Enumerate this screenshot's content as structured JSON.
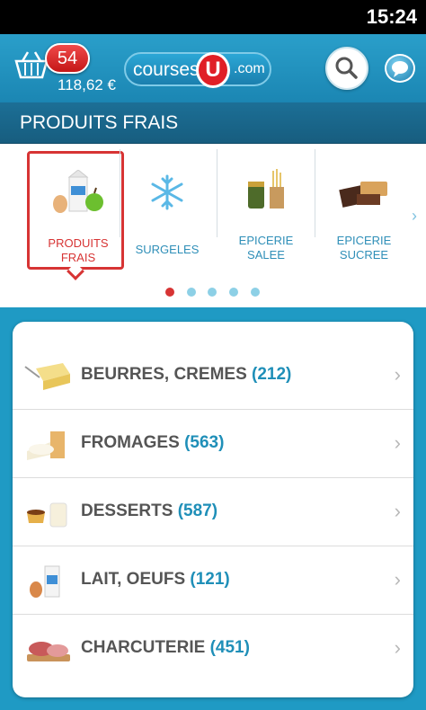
{
  "status_bar": {
    "time": "15:24"
  },
  "header": {
    "cart_count": "54",
    "cart_total": "118,62 €",
    "logo_part1": "courses",
    "logo_u": "U",
    "logo_part2": ".com"
  },
  "section": {
    "title": "PRODUITS FRAIS"
  },
  "carousel": {
    "items": [
      {
        "line1": "PRODUITS",
        "line2": "FRAIS",
        "active": true
      },
      {
        "line1": "SURGELES",
        "line2": "",
        "active": false
      },
      {
        "line1": "EPICERIE",
        "line2": "SALEE",
        "active": false
      },
      {
        "line1": "EPICERIE",
        "line2": "SUCREE",
        "active": false
      }
    ],
    "page_count": 5,
    "active_page": 1
  },
  "categories": [
    {
      "name": "BEURRES, CREMES",
      "count": "(212)"
    },
    {
      "name": "FROMAGES",
      "count": "(563)"
    },
    {
      "name": "DESSERTS",
      "count": "(587)"
    },
    {
      "name": "LAIT, OEUFS",
      "count": "(121)"
    },
    {
      "name": "CHARCUTERIE",
      "count": "(451)"
    }
  ]
}
